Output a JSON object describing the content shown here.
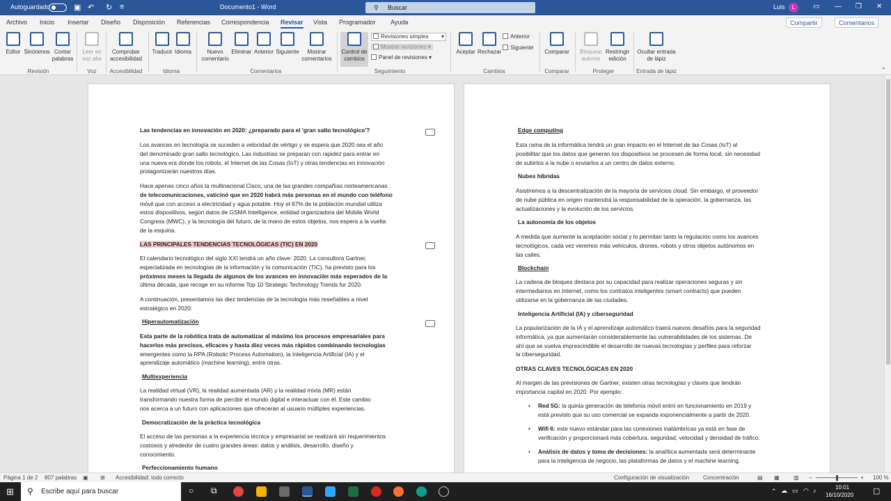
{
  "titlebar": {
    "autosave": "Autoguardado",
    "doc_title": "Documento1 - Word",
    "search": "Buscar",
    "user": "Luis",
    "initial": "L"
  },
  "tabs": [
    "Archivo",
    "Inicio",
    "Insertar",
    "Diseño",
    "Disposición",
    "Referencias",
    "Correspondencia",
    "Revisar",
    "Vista",
    "Programador",
    "Ayuda"
  ],
  "share": "Compartir",
  "comments": "Comentarios",
  "ribbon": {
    "editor": "Editor",
    "sinonimos": "Sinónimos",
    "contar": [
      "Contar",
      "palabras"
    ],
    "leer": [
      "Leer en",
      "voz alta"
    ],
    "comprobar": [
      "Comprobar",
      "accesibilidad"
    ],
    "traducir": "Traducir",
    "idioma": "Idioma",
    "nuevo": [
      "Nuevo",
      "comentario"
    ],
    "eliminar": "Eliminar",
    "anterior": "Anterior",
    "siguiente": "Siguiente",
    "mostrar_com": [
      "Mostrar",
      "comentarios"
    ],
    "control": [
      "Control de",
      "cambios"
    ],
    "revisiones_simples": "Revisiones simples",
    "mostrar_rev": "Mostrar revisiones",
    "panel_rev": "Panel de revisiones",
    "aceptar": "Aceptar",
    "rechazar": "Rechazar",
    "anterior2": "Anterior",
    "siguiente2": "Siguiente",
    "comparar": "Comparar",
    "bloquear": [
      "Bloquear",
      "autores"
    ],
    "restringir": [
      "Restringir",
      "edición"
    ],
    "ocultar": [
      "Ocultar entrada",
      "de lápiz"
    ],
    "groups": [
      "Revisión",
      "Voz",
      "Accesibilidad",
      "Idioma",
      "Comentarios",
      "Seguimiento",
      "Cambios",
      "Comparar",
      "Proteger",
      "Entrada de lápiz"
    ]
  },
  "page1": {
    "h1": "Las tendencias en innovación en 2020: ¿preparado para el 'gran salto tecnológico'?",
    "p1": [
      "Los avances en tecnología se suceden a velocidad de vértigo y se espera que 2020 sea el año",
      "del denominado gran salto tecnológico. Las industrias se preparan con rapidez para entrar en",
      "una nueva era donde los robots, el Internet de las Cosas (IoT) y otras tendencias en innovación",
      "protagonizarán nuestros días."
    ],
    "p2": [
      "Hace apenas cinco años la multinacional Cisco, una de las grandes compañías norteamericanas",
      "de telecomunicaciones, vaticinó que en 2020 habrá más personas en el mundo con teléfono",
      "móvil que con acceso a electricidad y agua potable. Hoy el 67% de la población mundial utiliza",
      "estos dispositivos, según datos de GSMA Intelligence, entidad organizadora del Mobile World",
      "Congress (MWC), y la tecnología del futuro, de la mano de estos objetos, nos espera a la vuelta",
      "de la esquina."
    ],
    "h2": "LAS PRINCIPALES TENDENCIAS TECNOLÓGICAS (TIC) EN 2020",
    "p3": [
      "El calendario tecnológico del siglo XXI tendrá un año clave: 2020. La consultora Gartner,",
      "especializada en tecnologías de la información y la comunicación (TIC), ha previsto para los",
      "próximos meses la llegada de algunos de los avances en innovación más esperados de la",
      "última década, que recoge en su informe Top 10 Strategic Technology Trends for 2020."
    ],
    "p4": [
      "A continuación, presentamos las diez tendencias de la tecnología más reseñables a nivel",
      "estratégico en 2020:"
    ],
    "h3": "Hiperautomatización",
    "p5": [
      "Esta parte de la robótica trata de automatizar al máximo los procesos empresariales para",
      "hacerlos más precisos, eficaces y hasta diez veces más rápidos combinando tecnologías",
      "emergentes como la RPA (Robotic Process Automation), la Inteligencia Artificial (IA) y el",
      "aprendizaje automático (machine learning), entre otras."
    ],
    "h4": "Multiexperiencia",
    "p6": [
      "La realidad virtual (VR), la realidad aumentada (AR) y la realidad mixta (MR) están",
      "transformando nuestra forma de percibir el mundo digital e interactuar con él. Este cambio",
      "nos acerca a un futuro con aplicaciones que ofrecerán al usuario múltiples experiencias."
    ],
    "h5": "Democratización de la práctica tecnológica",
    "p7": [
      "El acceso de las personas a la experiencia técnica y empresarial se realizará sin requerimientos",
      "costosos y alrededor de cuatro grandes áreas: datos y análisis, desarrollo, diseño y",
      "conocimiento."
    ],
    "h6": "Perfeccionamiento humano"
  },
  "page2": {
    "h1": "Edge computing",
    "p1": [
      "Esta rama de la informática tendrá un gran impacto en el Internet de las Cosas (IoT) al",
      "posibilitar que los datos que generan los dispositivos se procesen de forma local, sin necesidad",
      "de subirlos a la nube o enviarlos a un centro de datos externo."
    ],
    "h2": "Nubes híbridas",
    "p2": [
      "Asistiremos a la descentralización de la mayoría de servicios cloud. Sin embargo, el proveedor",
      "de nube pública en origen mantendrá la responsabilidad de la operación, la gobernanza, las",
      "actualizaciones y la evolución de los servicios."
    ],
    "h3": "La autonomía de los objetos",
    "p3": [
      "A medida que aumente la aceptación social y lo permitan tanto la regulación como los avances",
      "tecnológicos, cada vez veremos más vehículos, drones, robots y otros objetos autónomos en",
      "las calles."
    ],
    "h4": "Blockchain",
    "p4": [
      "La cadena de bloques destaca por su capacidad para realizar operaciones seguras y sin",
      "intermediarios en Internet, como los contratos inteligentes (smart contracts) que pueden",
      "utilizarse en la gobernanza de las ciudades."
    ],
    "h5": "Inteligencia Artificial (IA) y ciberseguridad",
    "p5": [
      "La popularización de la IA y el aprendizaje automático traerá nuevos desafíos para la seguridad",
      "informática, ya que aumentarán considerablemente las vulnerabilidades de los sistemas. De",
      "ahí que se vuelva imprescindible el desarrollo de nuevas tecnologías y perfiles para reforzar",
      "la ciberseguridad."
    ],
    "h6": "OTRAS CLAVES TECNOLÓGICAS EN 2020",
    "p6": [
      "Al margen de las previsiones de Gartner, existen otras tecnologías y claves que tendrán",
      "importancia capital en 2020. Por ejemplo:"
    ],
    "b1": [
      "Red 5G:",
      " la quinta generación de telefonía móvil entró en funcionamiento en 2019 y",
      "está previsto que su uso comercial se expanda exponencialmente a partir de 2020."
    ],
    "b2": [
      "Wifi 6:",
      " este nuevo estándar para las conexiones inalámbricas ya está en fase de",
      "verificación y proporcionará más cobertura, seguridad, velocidad y densidad de tráfico."
    ],
    "b3": [
      "Análisis de datos y toma de decisiones:",
      " la analítica aumentada será determinante",
      "para la inteligencia de negocio, las plataformas de datos y el machine learning."
    ]
  },
  "status": {
    "page": "Página 1 de 2",
    "words": "807 palabras",
    "access": "Accesibilidad: todo correcto",
    "display": "Configuración de visualización",
    "focus": "Concentración",
    "zoom": "100 %"
  },
  "taskbar": {
    "search": "Escribe aquí para buscar",
    "time": "10:01",
    "date": "16/10/2020"
  },
  "colors": {
    "accent": "#2b579a",
    "highlight": "#f4cccc"
  }
}
